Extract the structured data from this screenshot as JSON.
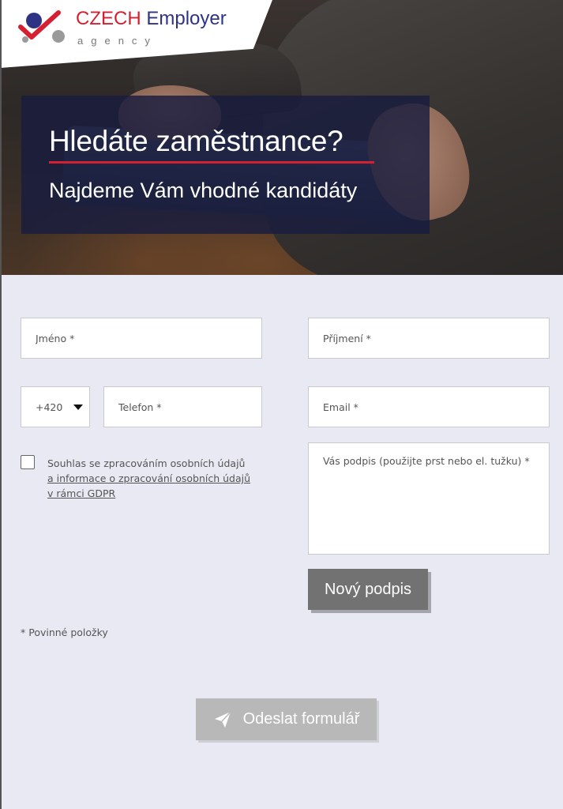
{
  "logo": {
    "czech": "CZECH",
    "employer": "Employer",
    "agency": "agency",
    "colors": {
      "red": "#d52031",
      "navy": "#2e3384",
      "grey": "#9a9a9a"
    }
  },
  "hero": {
    "headline": "Hledáte zaměstnance?",
    "subheadline": "Najdeme Vám vhodné kandidáty",
    "underline_color": "#d52031"
  },
  "form": {
    "first_name_placeholder": "Jméno *",
    "last_name_placeholder": "Příjmení *",
    "phone_prefix": "+420",
    "phone_placeholder": "Telefon *",
    "email_placeholder": "Email *",
    "signature_placeholder": "Vás podpis (použijte prst nebo el. tužku) *",
    "consent_text": "Souhlas se zpracováním osobních údajů",
    "consent_link_line1": "a informace o zpracování osobních údajů",
    "consent_link_line2": "v rámci GDPR",
    "consent_checked": false,
    "new_signature_button": "Nový podpis",
    "required_note": "* Povinné položky",
    "submit_button": "Odeslat formulář",
    "submit_icon": "paper-plane-icon"
  },
  "colors": {
    "page_background": "#e9e9f3",
    "button_dark": "#727272",
    "button_disabled": "#b8b8b8"
  }
}
